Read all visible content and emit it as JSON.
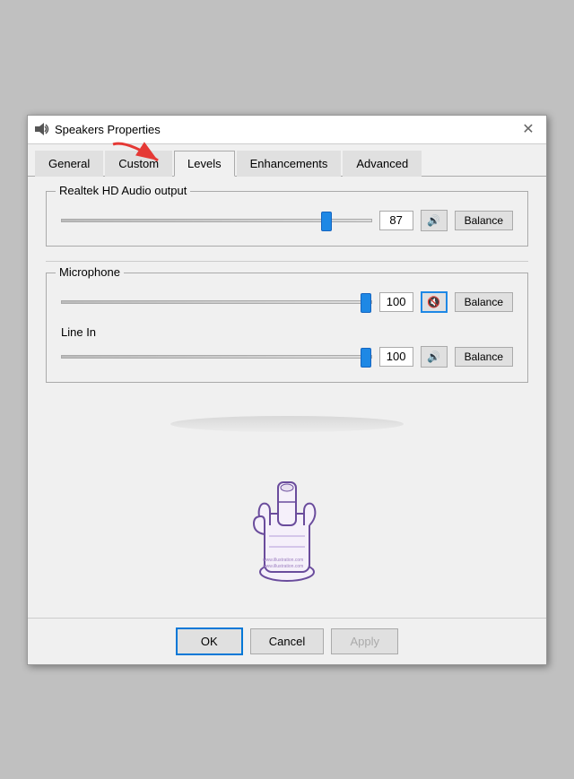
{
  "window": {
    "title": "Speakers Properties",
    "icon": "speaker"
  },
  "tabs": [
    {
      "label": "General",
      "active": false
    },
    {
      "label": "Custom",
      "active": false
    },
    {
      "label": "Levels",
      "active": true
    },
    {
      "label": "Enhancements",
      "active": false
    },
    {
      "label": "Advanced",
      "active": false
    }
  ],
  "sections": {
    "realtek": {
      "label": "Realtek HD Audio output",
      "value": 87,
      "max": 100,
      "muted": false,
      "mute_icon": "🔊"
    },
    "microphone": {
      "label": "Microphone",
      "value": 100,
      "max": 100,
      "muted": true,
      "mute_icon": "🔇"
    },
    "line_in": {
      "label": "Line In",
      "value": 100,
      "max": 100,
      "muted": false,
      "mute_icon": "🔊"
    }
  },
  "buttons": {
    "ok": "OK",
    "cancel": "Cancel",
    "apply": "Apply",
    "balance": "Balance"
  }
}
